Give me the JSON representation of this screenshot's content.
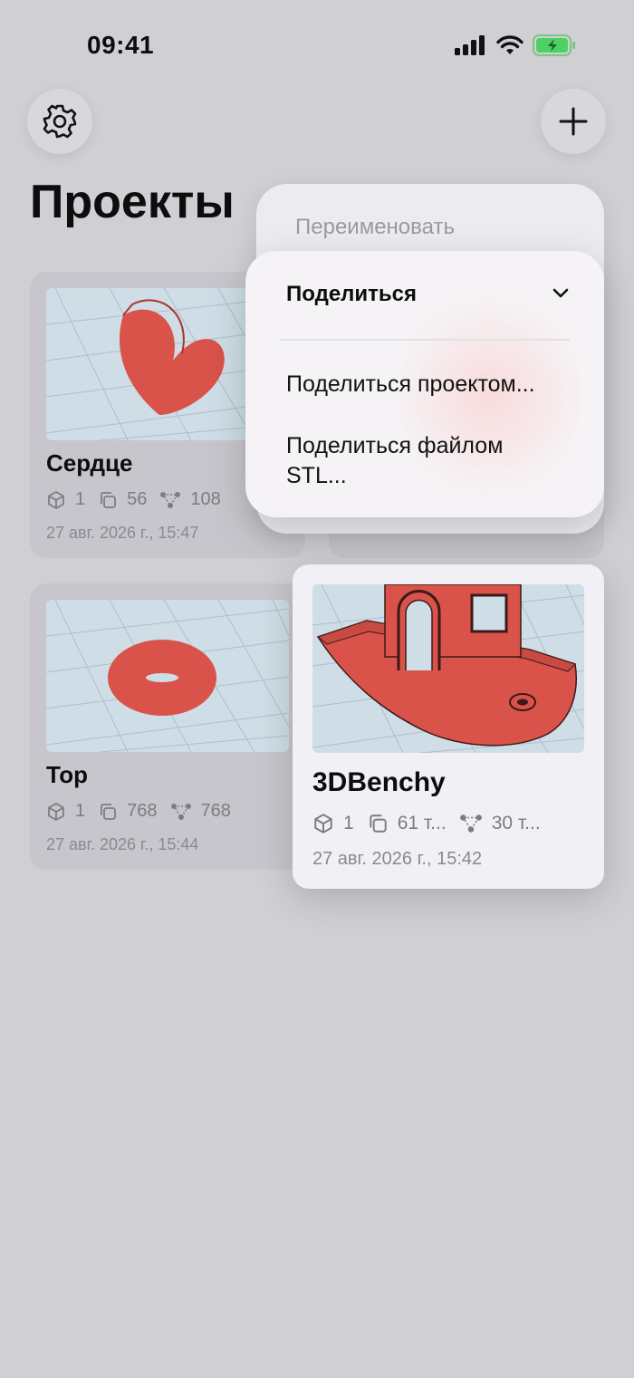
{
  "status_bar": {
    "time": "09:41"
  },
  "header": {
    "title": "Проекты",
    "settings_icon": "gear-icon",
    "add_icon": "plus-icon"
  },
  "projects": [
    {
      "name": "Сердце",
      "objects": "1",
      "triangles": "56",
      "vertices": "108",
      "date": "27 авг. 2026 г., 15:47"
    },
    {
      "name": "Тор",
      "objects": "1",
      "triangles": "768",
      "vertices": "768",
      "date": "27 авг. 2026 г., 15:44"
    },
    {
      "name": "3DBenchy",
      "objects": "1",
      "triangles": "61 т...",
      "vertices": "30 т...",
      "date": "27 авг. 2026 г., 15:42"
    }
  ],
  "context_menu": {
    "rename_label": "Переименовать",
    "share_header": "Поделиться",
    "items": [
      "Поделиться проектом...",
      "Поделиться файлом STL..."
    ]
  },
  "colors": {
    "background": "#d0cfd4",
    "model": "#d9534a",
    "grid": "#cfdde6"
  }
}
